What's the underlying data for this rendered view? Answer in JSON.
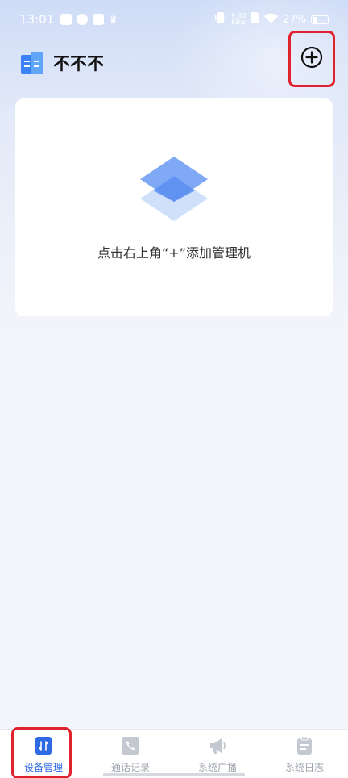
{
  "status_bar": {
    "time": "13:01",
    "network_speed_value": "9.80",
    "network_speed_unit": "KB/s",
    "battery": "27%"
  },
  "header": {
    "title": "不不不"
  },
  "empty_state": {
    "message": "点击右上角“+”添加管理机"
  },
  "nav": {
    "items": [
      {
        "label": "设备管理",
        "active": true
      },
      {
        "label": "通话记录",
        "active": false
      },
      {
        "label": "系统广播",
        "active": false
      },
      {
        "label": "系统日志",
        "active": false
      }
    ]
  },
  "colors": {
    "accent": "#2d6ae3",
    "highlight": "#e0212e",
    "inactive": "#9ea3ad"
  }
}
